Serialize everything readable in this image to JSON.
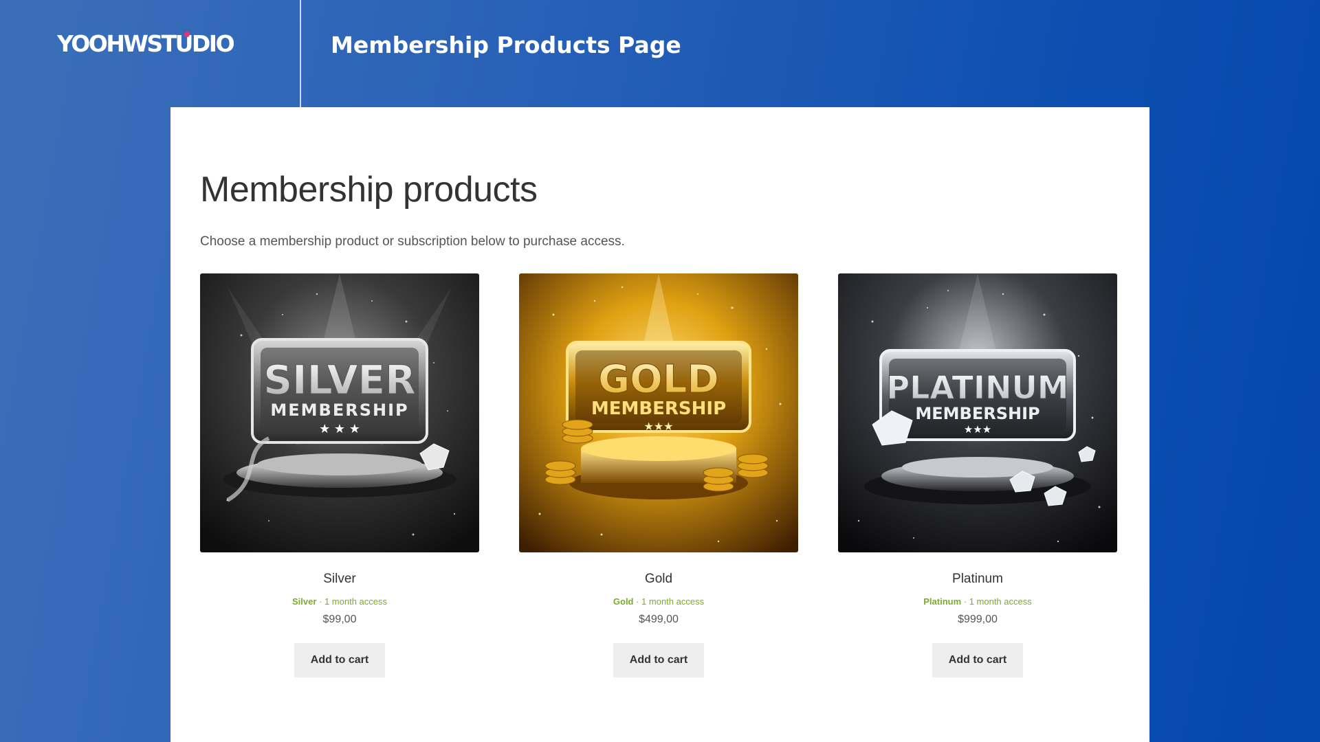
{
  "brand": {
    "logo_text": "YOOHWSTUDIO"
  },
  "header": {
    "title": "Membership Products Page"
  },
  "page": {
    "heading": "Membership products",
    "intro": "Choose a membership product or subscription below to purchase access."
  },
  "products": [
    {
      "name": "Silver",
      "plan": "Silver",
      "access": " · 1 month access",
      "price": "$99,00",
      "button": "Add to cart",
      "image_title": "SILVER",
      "image_subtitle": "MEMBERSHIP",
      "theme": "silver"
    },
    {
      "name": "Gold",
      "plan": "Gold",
      "access": " · 1 month access",
      "price": "$499,00",
      "button": "Add to cart",
      "image_title": "GOLD",
      "image_subtitle": "MEMBERSHIP",
      "theme": "gold"
    },
    {
      "name": "Platinum",
      "plan": "Platinum",
      "access": " · 1 month access",
      "price": "$999,00",
      "button": "Add to cart",
      "image_title": "PLATINUM",
      "image_subtitle": "MEMBERSHIP",
      "theme": "platinum"
    }
  ],
  "colors": {
    "accent_green": "#7bab29",
    "brand_dot": "#e8336e",
    "background_blue": "#1a58b3"
  }
}
